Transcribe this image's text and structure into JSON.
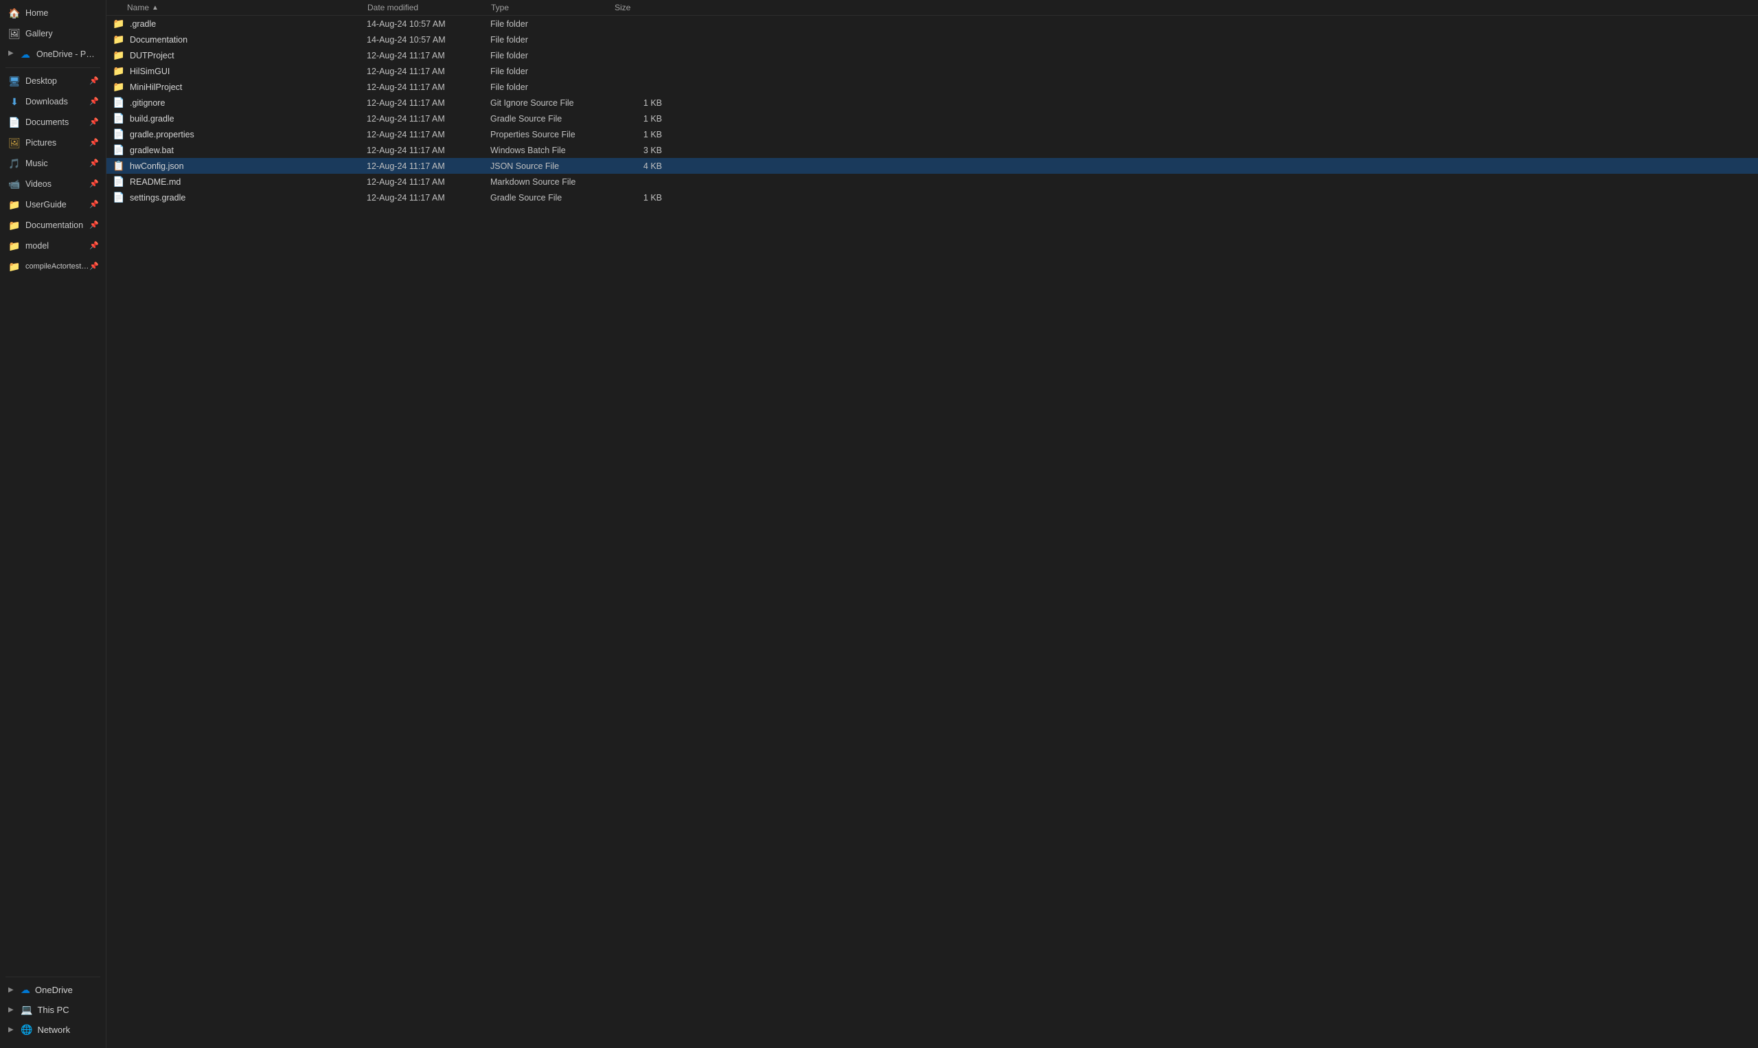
{
  "sidebar": {
    "items": [
      {
        "id": "home",
        "label": "Home",
        "icon": "🏠",
        "pinned": false,
        "chevron": false
      },
      {
        "id": "gallery",
        "label": "Gallery",
        "icon": "🖼",
        "pinned": false,
        "chevron": false
      },
      {
        "id": "onedrive-personal",
        "label": "OneDrive - Personal",
        "icon": "☁",
        "pinned": false,
        "chevron": true,
        "expanded": false
      },
      {
        "id": "desktop",
        "label": "Desktop",
        "icon": "🖥",
        "pinned": true,
        "chevron": false
      },
      {
        "id": "downloads",
        "label": "Downloads",
        "icon": "⬇",
        "pinned": true,
        "chevron": false
      },
      {
        "id": "documents",
        "label": "Documents",
        "icon": "📄",
        "pinned": true,
        "chevron": false
      },
      {
        "id": "pictures",
        "label": "Pictures",
        "icon": "🖼",
        "pinned": true,
        "chevron": false
      },
      {
        "id": "music",
        "label": "Music",
        "icon": "🎵",
        "pinned": true,
        "chevron": false
      },
      {
        "id": "videos",
        "label": "Videos",
        "icon": "📹",
        "pinned": true,
        "chevron": false
      },
      {
        "id": "userguide",
        "label": "UserGuide",
        "icon": "📁",
        "pinned": true,
        "chevron": false
      },
      {
        "id": "documentation",
        "label": "Documentation",
        "icon": "📁",
        "pinned": true,
        "chevron": false
      },
      {
        "id": "model",
        "label": "model",
        "icon": "📁",
        "pinned": true,
        "chevron": false
      },
      {
        "id": "compileactortest",
        "label": "compileActortest_gen...",
        "icon": "📁",
        "pinned": true,
        "chevron": false
      }
    ],
    "sections": [
      {
        "id": "onedrive",
        "label": "OneDrive",
        "icon": "☁",
        "chevron": true
      },
      {
        "id": "this-pc",
        "label": "This PC",
        "icon": "💻",
        "chevron": true
      },
      {
        "id": "network",
        "label": "Network",
        "icon": "🌐",
        "chevron": true
      }
    ]
  },
  "columns": {
    "name": "Name",
    "date_modified": "Date modified",
    "type": "Type",
    "size": "Size"
  },
  "files": [
    {
      "id": 1,
      "name": ".gradle",
      "date": "14-Aug-24 10:57 AM",
      "type": "File folder",
      "size": "",
      "icon": "folder",
      "selected": false
    },
    {
      "id": 2,
      "name": "Documentation",
      "date": "14-Aug-24 10:57 AM",
      "type": "File folder",
      "size": "",
      "icon": "folder",
      "selected": false
    },
    {
      "id": 3,
      "name": "DUTProject",
      "date": "12-Aug-24 11:17 AM",
      "type": "File folder",
      "size": "",
      "icon": "folder",
      "selected": false
    },
    {
      "id": 4,
      "name": "HilSimGUI",
      "date": "12-Aug-24 11:17 AM",
      "type": "File folder",
      "size": "",
      "icon": "folder",
      "selected": false
    },
    {
      "id": 5,
      "name": "MiniHilProject",
      "date": "12-Aug-24 11:17 AM",
      "type": "File folder",
      "size": "",
      "icon": "folder",
      "selected": false
    },
    {
      "id": 6,
      "name": ".gitignore",
      "date": "12-Aug-24 11:17 AM",
      "type": "Git Ignore Source File",
      "size": "1 KB",
      "icon": "file",
      "selected": false
    },
    {
      "id": 7,
      "name": "build.gradle",
      "date": "12-Aug-24 11:17 AM",
      "type": "Gradle Source File",
      "size": "1 KB",
      "icon": "gradle",
      "selected": false
    },
    {
      "id": 8,
      "name": "gradle.properties",
      "date": "12-Aug-24 11:17 AM",
      "type": "Properties Source File",
      "size": "1 KB",
      "icon": "file",
      "selected": false
    },
    {
      "id": 9,
      "name": "gradlew.bat",
      "date": "12-Aug-24 11:17 AM",
      "type": "Windows Batch File",
      "size": "3 KB",
      "icon": "bat",
      "selected": false
    },
    {
      "id": 10,
      "name": "hwConfig.json",
      "date": "12-Aug-24 11:17 AM",
      "type": "JSON Source File",
      "size": "4 KB",
      "icon": "json",
      "selected": true
    },
    {
      "id": 11,
      "name": "README.md",
      "date": "12-Aug-24 11:17 AM",
      "type": "Markdown Source File",
      "size": "",
      "icon": "md",
      "selected": false
    },
    {
      "id": 12,
      "name": "settings.gradle",
      "date": "12-Aug-24 11:17 AM",
      "type": "Gradle Source File",
      "size": "1 KB",
      "icon": "gradle",
      "selected": false
    }
  ]
}
